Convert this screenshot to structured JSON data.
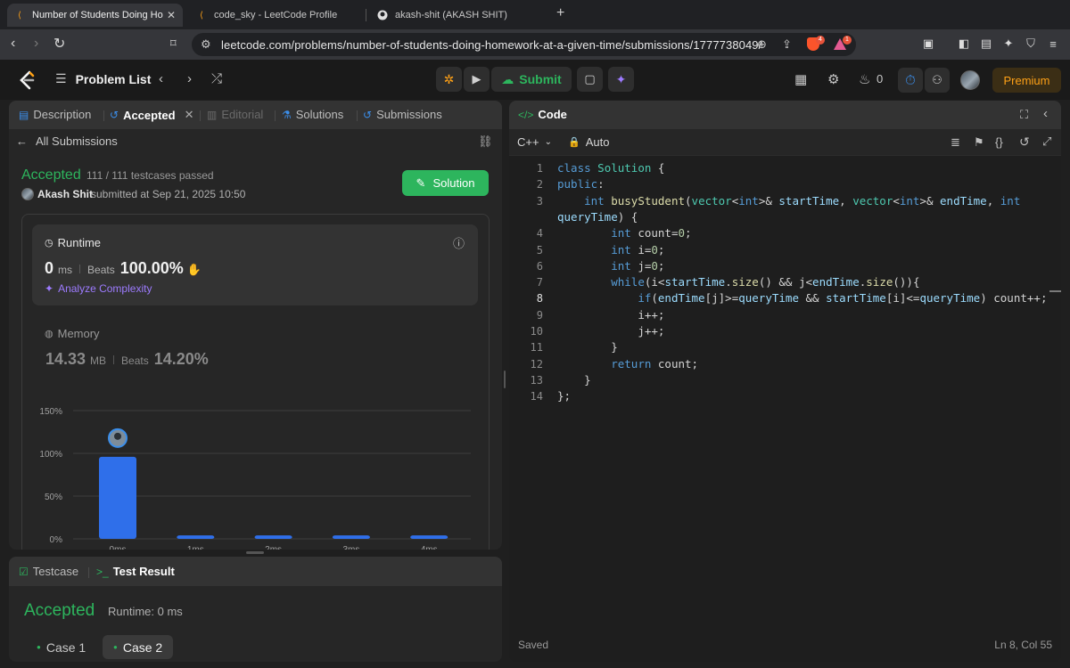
{
  "browser": {
    "tabs": [
      {
        "title": "Number of Students Doing Ho",
        "active": true
      },
      {
        "title": "code_sky - LeetCode Profile",
        "active": false
      },
      {
        "title": "akash-shit (AKASH SHIT)",
        "active": false
      }
    ],
    "url": "leetcode.com/problems/number-of-students-doing-homework-at-a-given-time/submissions/1777738049/",
    "ext_badges": {
      "brave": "4",
      "alert": "1"
    }
  },
  "header": {
    "problem_list": "Problem List",
    "submit": "Submit",
    "streak": "0",
    "premium": "Premium"
  },
  "left": {
    "tabs": {
      "description": "Description",
      "accepted": "Accepted",
      "editorial": "Editorial",
      "solutions": "Solutions",
      "submissions": "Submissions"
    },
    "all_submissions": "All Submissions",
    "status": "Accepted",
    "testcases": "111 / 111 testcases passed",
    "user": "Akash Shit",
    "submitted_at": "submitted at Sep 21, 2025 10:50",
    "solution_btn": "Solution",
    "runtime": {
      "label": "Runtime",
      "value": "0",
      "unit": "ms",
      "beats_label": "Beats",
      "beats": "100.00%",
      "analyze": "Analyze Complexity"
    },
    "memory": {
      "label": "Memory",
      "value": "14.33",
      "unit": "MB",
      "beats_label": "Beats",
      "beats": "14.20%"
    }
  },
  "chart_data": {
    "type": "bar",
    "categories": [
      "0ms",
      "1ms",
      "2ms",
      "3ms",
      "4ms"
    ],
    "values": [
      96,
      4,
      4,
      4,
      4
    ],
    "yticks": [
      "0%",
      "50%",
      "100%",
      "150%"
    ],
    "ylim": [
      0,
      150
    ],
    "color": "#2f6fea"
  },
  "code_panel": {
    "title": "Code",
    "language": "C++",
    "mode": "Auto",
    "saved": "Saved",
    "cursor": "Ln 8, Col 55",
    "lines": [
      {
        "num": "1",
        "text": "class Solution {"
      },
      {
        "num": "2",
        "text": "public:"
      },
      {
        "num": "3",
        "text": "    int busyStudent(vector<int>& startTime, vector<int>& endTime, int"
      },
      {
        "num": "",
        "text": "queryTime) {"
      },
      {
        "num": "4",
        "text": "        int count=0;"
      },
      {
        "num": "5",
        "text": "        int i=0;"
      },
      {
        "num": "6",
        "text": "        int j=0;"
      },
      {
        "num": "7",
        "text": "        while(i<startTime.size() && j<endTime.size()){"
      },
      {
        "num": "8",
        "text": "            if(endTime[j]>=queryTime && startTime[i]<=queryTime) count++;"
      },
      {
        "num": "9",
        "text": "            i++;"
      },
      {
        "num": "10",
        "text": "            j++;"
      },
      {
        "num": "11",
        "text": "        }"
      },
      {
        "num": "12",
        "text": "        return count;"
      },
      {
        "num": "13",
        "text": "    }"
      },
      {
        "num": "14",
        "text": "};"
      }
    ]
  },
  "bottom": {
    "testcase": "Testcase",
    "test_result": "Test Result",
    "status": "Accepted",
    "runtime": "Runtime: 0 ms",
    "case1": "Case 1",
    "case2": "Case 2"
  }
}
